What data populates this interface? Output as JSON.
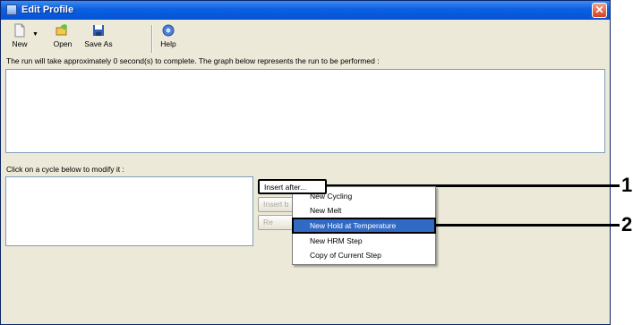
{
  "window": {
    "title": "Edit Profile",
    "close_glyph": "✕"
  },
  "toolbar": {
    "new_label": "New",
    "open_label": "Open",
    "save_as_label": "Save As",
    "help_label": "Help",
    "dropdown_glyph": "▼"
  },
  "info_text": "The run will take approximately 0 second(s) to complete. The graph below represents the run to be performed :",
  "cycle_prompt": "Click on a cycle below to modify it :",
  "buttons": {
    "insert_after": "Insert after...",
    "insert_before": "Insert b",
    "remove": "Re"
  },
  "context_menu": {
    "items": [
      {
        "label": "New Cycling"
      },
      {
        "label": "New Melt"
      },
      {
        "label": "New Hold at Temperature",
        "selected": true
      },
      {
        "label": "New HRM Step"
      },
      {
        "label": "Copy of Current Step"
      }
    ]
  },
  "callouts": [
    "1",
    "2"
  ],
  "icons": {
    "new": "new-document-icon",
    "open": "open-folder-icon",
    "save_as": "floppy-disk-icon",
    "help": "help-icon"
  },
  "colors": {
    "title_bar": "#0a5fe0",
    "selection": "#316ac5",
    "window_bg": "#ece9d8",
    "close": "#d6401f"
  }
}
